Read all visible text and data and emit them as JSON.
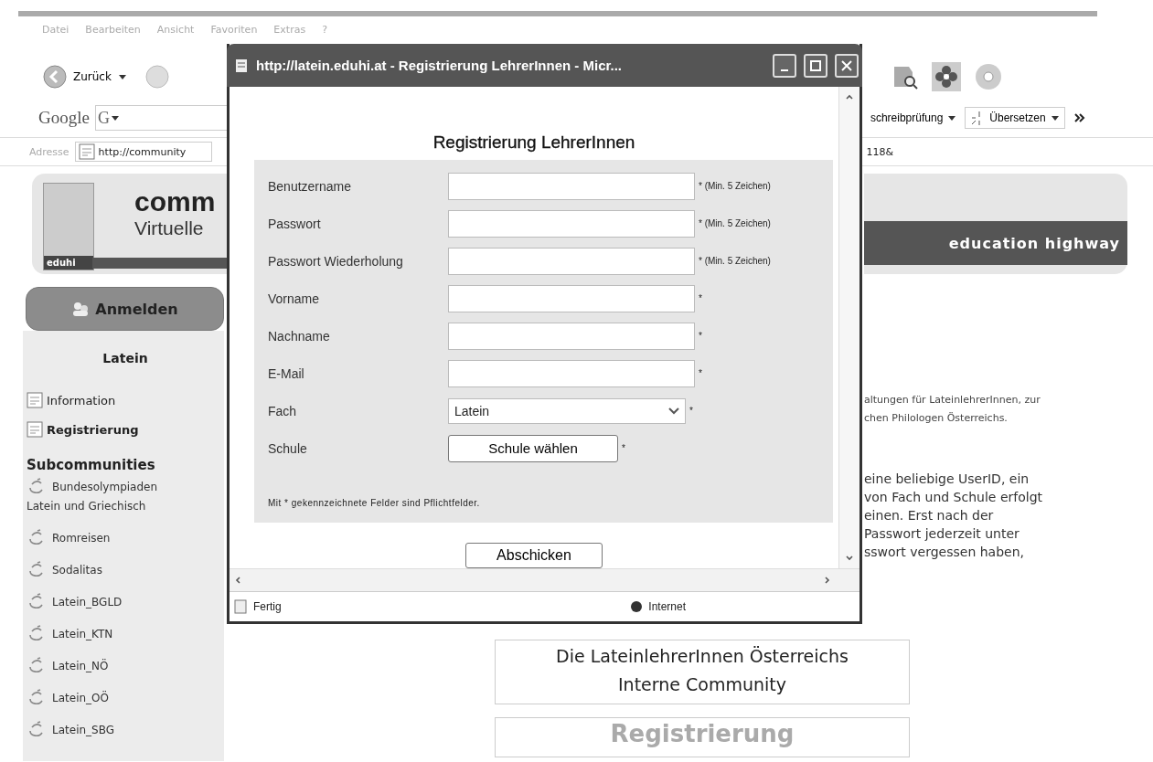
{
  "menu": [
    "Datei",
    "Bearbeiten",
    "Ansicht",
    "Favoriten",
    "Extras",
    "?"
  ],
  "toolbar": {
    "back_label": "Zurück"
  },
  "google_bar": {
    "logo": "Google",
    "search_button": "G",
    "right_items": [
      {
        "label": "schreibprüfung"
      },
      {
        "label": "Übersetzen"
      }
    ]
  },
  "address_bar": {
    "label": "Adresse",
    "url_visible": "http://community",
    "url_tail": "118&"
  },
  "header": {
    "title_visible": "comm",
    "subtitle_visible": "Virtuelle",
    "logo_text": "eduhi",
    "tagline": "education highway"
  },
  "sidebar": {
    "login_button": "Anmelden",
    "section_title": "Latein",
    "items": [
      {
        "label": "Information",
        "selected": false
      },
      {
        "label": "Registrierung",
        "selected": true
      }
    ],
    "subcommunities_title": "Subcommunities",
    "subcommunities": [
      "Bundesolympiaden Latein und Griechisch",
      "Romreisen",
      "Sodalitas",
      "Latein_BGLD",
      "Latein_KTN",
      "Latein_NÖ",
      "Latein_OÖ",
      "Latein_SBG"
    ]
  },
  "intro_lines": [
    "altungen für LateinlehrerInnen, zur",
    "chen Philologen Österreichs."
  ],
  "info_lines": [
    "eine beliebige UserID, ein",
    "von Fach und Schule erfolgt",
    "einen. Erst nach der",
    "Passwort jederzeit unter",
    "sswort vergessen haben,"
  ],
  "community_box": {
    "line_1": "Die LateinlehrerInnen Österreichs",
    "line_2": "Interne Community"
  },
  "registration_box": "Registrierung",
  "popup": {
    "title": "http://latein.eduhi.at - Registrierung LehrerInnen - Micr...",
    "heading": "Registrierung LehrerInnen",
    "fields": [
      {
        "label": "Benutzername",
        "kind": "text",
        "hint": "* (Min. 5 Zeichen)"
      },
      {
        "label": "Passwort",
        "kind": "text",
        "hint": "* (Min. 5 Zeichen)"
      },
      {
        "label": "Passwort Wiederholung",
        "kind": "text",
        "hint": "* (Min. 5 Zeichen)"
      },
      {
        "label": "Vorname",
        "kind": "text",
        "hint": "*"
      },
      {
        "label": "Nachname",
        "kind": "text",
        "hint": "*"
      },
      {
        "label": "E-Mail",
        "kind": "text",
        "hint": "*"
      },
      {
        "label": "Fach",
        "kind": "select",
        "value": "Latein",
        "hint": "*"
      },
      {
        "label": "Schule",
        "kind": "button",
        "value": "Schule wählen",
        "hint": "*"
      }
    ],
    "note": "Mit * gekennzeichnete Felder sind Pflichtfelder.",
    "submit": "Abschicken",
    "status": "Fertig",
    "zone": "Internet"
  }
}
